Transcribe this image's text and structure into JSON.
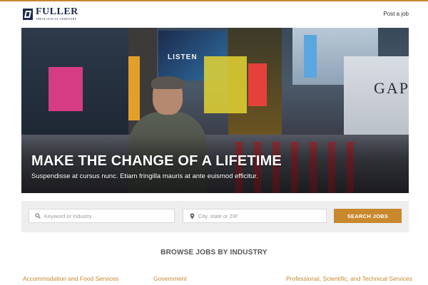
{
  "header": {
    "logo_name": "FULLER",
    "logo_sub": "THEOLOGICAL SEMINARY",
    "post_job": "Post a job"
  },
  "hero": {
    "title": "MAKE THE CHANGE OF A LIFETIME",
    "subtitle": "Suspendisse at cursus nunc. Etiam fringilla mauris at ante euismod efficitur.",
    "sign_text": "LISTEN",
    "store_text": "GAP"
  },
  "search": {
    "keyword_placeholder": "Keyword or Industry",
    "location_placeholder": "City, state or ZIP",
    "button_label": "SEARCH JOBS"
  },
  "browse": {
    "title": "BROWSE JOBS BY INDUSTRY",
    "industries": [
      "Accommodation and Food Services",
      "Government",
      "Professional, Scientific, and Technical Services"
    ]
  },
  "colors": {
    "accent": "#c8882e",
    "brand_navy": "#1f2a4f",
    "search_bg": "#eeeeee"
  },
  "icons": {
    "keyword_field": "search-icon",
    "location_field": "map-pin-icon"
  }
}
